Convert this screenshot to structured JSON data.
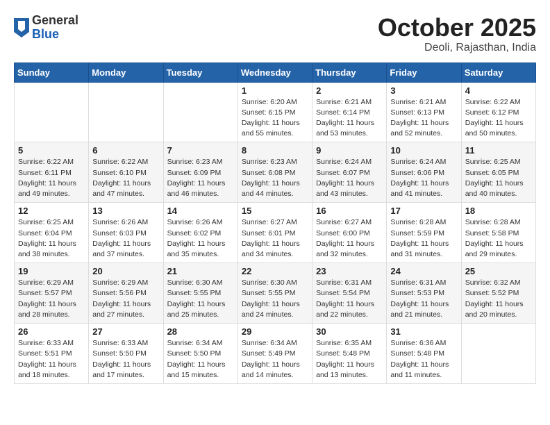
{
  "header": {
    "logo_general": "General",
    "logo_blue": "Blue",
    "month_title": "October 2025",
    "location": "Deoli, Rajasthan, India"
  },
  "weekdays": [
    "Sunday",
    "Monday",
    "Tuesday",
    "Wednesday",
    "Thursday",
    "Friday",
    "Saturday"
  ],
  "weeks": [
    [
      {
        "day": "",
        "info": ""
      },
      {
        "day": "",
        "info": ""
      },
      {
        "day": "",
        "info": ""
      },
      {
        "day": "1",
        "info": "Sunrise: 6:20 AM\nSunset: 6:15 PM\nDaylight: 11 hours\nand 55 minutes."
      },
      {
        "day": "2",
        "info": "Sunrise: 6:21 AM\nSunset: 6:14 PM\nDaylight: 11 hours\nand 53 minutes."
      },
      {
        "day": "3",
        "info": "Sunrise: 6:21 AM\nSunset: 6:13 PM\nDaylight: 11 hours\nand 52 minutes."
      },
      {
        "day": "4",
        "info": "Sunrise: 6:22 AM\nSunset: 6:12 PM\nDaylight: 11 hours\nand 50 minutes."
      }
    ],
    [
      {
        "day": "5",
        "info": "Sunrise: 6:22 AM\nSunset: 6:11 PM\nDaylight: 11 hours\nand 49 minutes."
      },
      {
        "day": "6",
        "info": "Sunrise: 6:22 AM\nSunset: 6:10 PM\nDaylight: 11 hours\nand 47 minutes."
      },
      {
        "day": "7",
        "info": "Sunrise: 6:23 AM\nSunset: 6:09 PM\nDaylight: 11 hours\nand 46 minutes."
      },
      {
        "day": "8",
        "info": "Sunrise: 6:23 AM\nSunset: 6:08 PM\nDaylight: 11 hours\nand 44 minutes."
      },
      {
        "day": "9",
        "info": "Sunrise: 6:24 AM\nSunset: 6:07 PM\nDaylight: 11 hours\nand 43 minutes."
      },
      {
        "day": "10",
        "info": "Sunrise: 6:24 AM\nSunset: 6:06 PM\nDaylight: 11 hours\nand 41 minutes."
      },
      {
        "day": "11",
        "info": "Sunrise: 6:25 AM\nSunset: 6:05 PM\nDaylight: 11 hours\nand 40 minutes."
      }
    ],
    [
      {
        "day": "12",
        "info": "Sunrise: 6:25 AM\nSunset: 6:04 PM\nDaylight: 11 hours\nand 38 minutes."
      },
      {
        "day": "13",
        "info": "Sunrise: 6:26 AM\nSunset: 6:03 PM\nDaylight: 11 hours\nand 37 minutes."
      },
      {
        "day": "14",
        "info": "Sunrise: 6:26 AM\nSunset: 6:02 PM\nDaylight: 11 hours\nand 35 minutes."
      },
      {
        "day": "15",
        "info": "Sunrise: 6:27 AM\nSunset: 6:01 PM\nDaylight: 11 hours\nand 34 minutes."
      },
      {
        "day": "16",
        "info": "Sunrise: 6:27 AM\nSunset: 6:00 PM\nDaylight: 11 hours\nand 32 minutes."
      },
      {
        "day": "17",
        "info": "Sunrise: 6:28 AM\nSunset: 5:59 PM\nDaylight: 11 hours\nand 31 minutes."
      },
      {
        "day": "18",
        "info": "Sunrise: 6:28 AM\nSunset: 5:58 PM\nDaylight: 11 hours\nand 29 minutes."
      }
    ],
    [
      {
        "day": "19",
        "info": "Sunrise: 6:29 AM\nSunset: 5:57 PM\nDaylight: 11 hours\nand 28 minutes."
      },
      {
        "day": "20",
        "info": "Sunrise: 6:29 AM\nSunset: 5:56 PM\nDaylight: 11 hours\nand 27 minutes."
      },
      {
        "day": "21",
        "info": "Sunrise: 6:30 AM\nSunset: 5:55 PM\nDaylight: 11 hours\nand 25 minutes."
      },
      {
        "day": "22",
        "info": "Sunrise: 6:30 AM\nSunset: 5:55 PM\nDaylight: 11 hours\nand 24 minutes."
      },
      {
        "day": "23",
        "info": "Sunrise: 6:31 AM\nSunset: 5:54 PM\nDaylight: 11 hours\nand 22 minutes."
      },
      {
        "day": "24",
        "info": "Sunrise: 6:31 AM\nSunset: 5:53 PM\nDaylight: 11 hours\nand 21 minutes."
      },
      {
        "day": "25",
        "info": "Sunrise: 6:32 AM\nSunset: 5:52 PM\nDaylight: 11 hours\nand 20 minutes."
      }
    ],
    [
      {
        "day": "26",
        "info": "Sunrise: 6:33 AM\nSunset: 5:51 PM\nDaylight: 11 hours\nand 18 minutes."
      },
      {
        "day": "27",
        "info": "Sunrise: 6:33 AM\nSunset: 5:50 PM\nDaylight: 11 hours\nand 17 minutes."
      },
      {
        "day": "28",
        "info": "Sunrise: 6:34 AM\nSunset: 5:50 PM\nDaylight: 11 hours\nand 15 minutes."
      },
      {
        "day": "29",
        "info": "Sunrise: 6:34 AM\nSunset: 5:49 PM\nDaylight: 11 hours\nand 14 minutes."
      },
      {
        "day": "30",
        "info": "Sunrise: 6:35 AM\nSunset: 5:48 PM\nDaylight: 11 hours\nand 13 minutes."
      },
      {
        "day": "31",
        "info": "Sunrise: 6:36 AM\nSunset: 5:48 PM\nDaylight: 11 hours\nand 11 minutes."
      },
      {
        "day": "",
        "info": ""
      }
    ]
  ]
}
